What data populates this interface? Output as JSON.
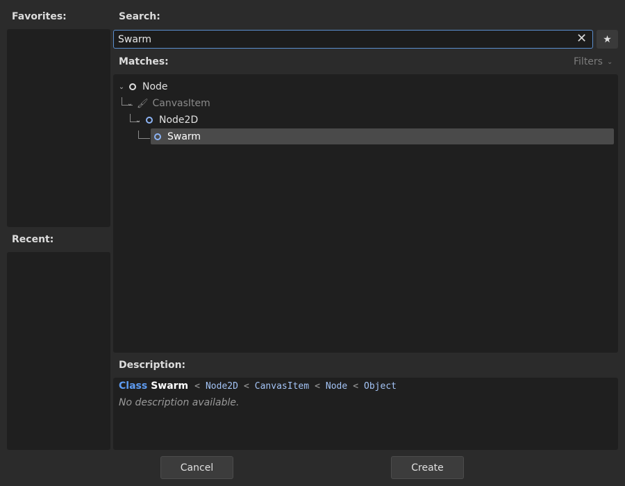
{
  "favorites": {
    "label": "Favorites:"
  },
  "recent": {
    "label": "Recent:"
  },
  "search": {
    "label": "Search:",
    "value": "Swarm",
    "clear_icon": "close-icon",
    "favorite_icon": "star-icon"
  },
  "matches": {
    "label": "Matches:",
    "filters_label": "Filters",
    "tree": [
      {
        "name": "Node",
        "icon": "circle-icon",
        "depth": 0,
        "enabled": true,
        "selected": false
      },
      {
        "name": "CanvasItem",
        "icon": "brush-icon",
        "depth": 1,
        "enabled": false,
        "selected": false
      },
      {
        "name": "Node2D",
        "icon": "circle-icon",
        "depth": 2,
        "enabled": true,
        "selected": false
      },
      {
        "name": "Swarm",
        "icon": "circle-icon",
        "depth": 3,
        "enabled": true,
        "selected": true
      }
    ]
  },
  "description": {
    "label": "Description:",
    "class_keyword": "Class",
    "class_name": "Swarm",
    "inheritance": [
      "Node2D",
      "CanvasItem",
      "Node",
      "Object"
    ],
    "separator": "<",
    "text": "No description available."
  },
  "buttons": {
    "cancel": "Cancel",
    "create": "Create"
  },
  "colors": {
    "background": "#2b2b2b",
    "panel": "#1f1f1f",
    "accent": "#5b8fcf",
    "class_keyword": "#5e9cf2",
    "inheritance": "#a3c3f5"
  }
}
